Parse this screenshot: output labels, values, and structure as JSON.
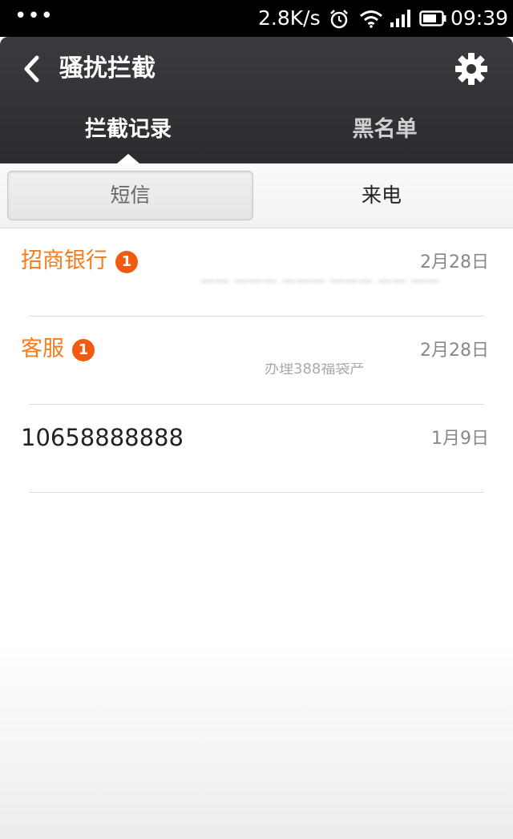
{
  "status_bar": {
    "dots": "•••",
    "speed": "2.8K/s",
    "time": "09:39"
  },
  "header": {
    "title": "骚扰拦截",
    "tabs": [
      {
        "label": "拦截记录"
      },
      {
        "label": "黑名单"
      }
    ]
  },
  "segments": {
    "sms": "短信",
    "calls": "来电"
  },
  "messages": [
    {
      "sender": "招商银行",
      "badge": "1",
      "date": "2月28日",
      "preview": "—— ——— ——— ——— —— ——"
    },
    {
      "sender": "客服",
      "badge": "1",
      "date": "2月28日",
      "preview": "办理388福袋产"
    },
    {
      "sender": "10658888888",
      "date": "1月9日"
    }
  ],
  "colors": {
    "accent_orange": "#f47c1c",
    "badge_orange": "#f25a0f",
    "header_dark": "#2b2c2f"
  }
}
